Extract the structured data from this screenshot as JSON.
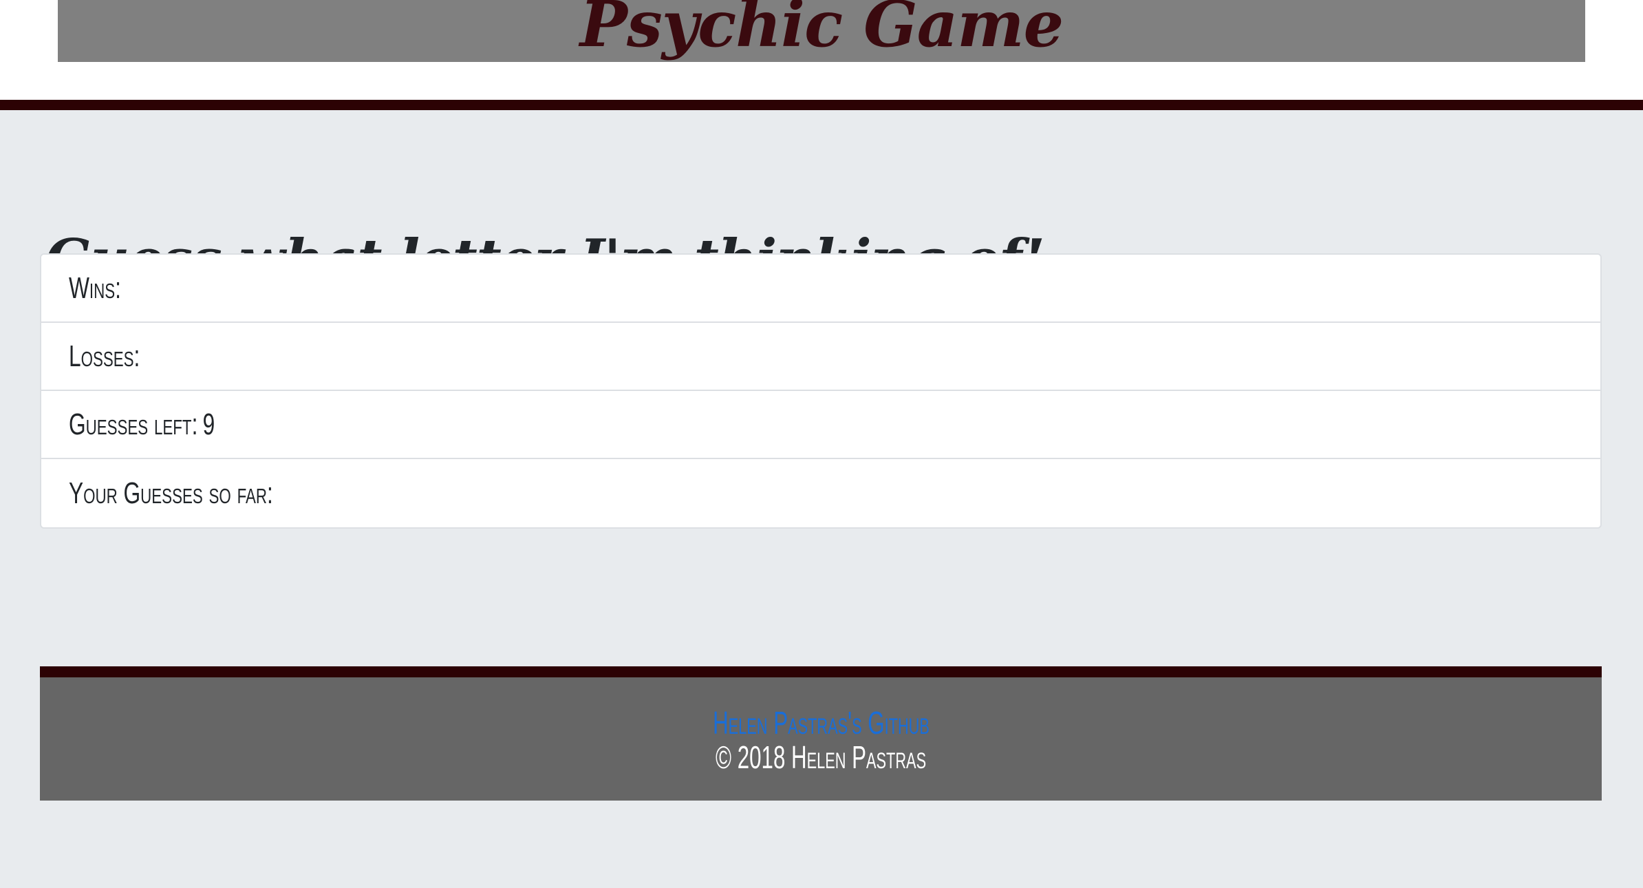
{
  "header": {
    "title": "Psychic Game"
  },
  "main": {
    "headline": "Guess what letter I'm thinking of!",
    "stats": [
      {
        "label": "Wins:",
        "value": ""
      },
      {
        "label": "Losses:",
        "value": ""
      },
      {
        "label": "Guesses left:",
        "value": "9"
      },
      {
        "label": "Your Guesses so far:",
        "value": ""
      }
    ]
  },
  "footer": {
    "link_text": "Helen Pastras's Github",
    "copyright": "© 2018 Helen Pastras"
  },
  "colors": {
    "page_background": "#e8ebee",
    "title_banner": "#808080",
    "title_text": "#3a0a0f",
    "accent_rule": "#2c0204",
    "footer_background": "#666666",
    "link": "#1a6ed8"
  }
}
